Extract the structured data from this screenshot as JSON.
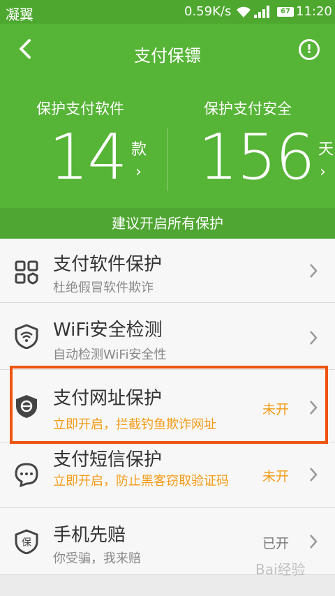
{
  "status_bar": {
    "carrier": "凝翼",
    "speed": "0.59K/s",
    "battery": "67",
    "time": "11:20"
  },
  "header": {
    "title": "支付保镖",
    "back_icon": "chevron-left-icon",
    "alert_icon": "exclamation-circle-icon"
  },
  "stats": {
    "apps": {
      "label": "保护支付软件",
      "value": "14",
      "unit": "款",
      "arrow": "›"
    },
    "days": {
      "label": "保护支付安全",
      "value": "156",
      "unit": "天",
      "arrow": "›"
    }
  },
  "recommend": "建议开启所有保护",
  "items": [
    {
      "title": "支付软件保护",
      "subtitle": "杜绝假冒软件欺诈",
      "status": "",
      "icon": "apps-grid-icon"
    },
    {
      "title": "WiFi安全检测",
      "subtitle": "自动检测WiFi安全性",
      "status": "",
      "icon": "wifi-shield-icon"
    },
    {
      "title": "支付网址保护",
      "subtitle": "立即开启，拦截钓鱼欺诈网址",
      "status": "未开",
      "icon": "browser-shield-icon"
    },
    {
      "title": "支付短信保护",
      "subtitle": "立即开启，防止黑客窃取验证码",
      "status": "未开",
      "icon": "message-icon"
    },
    {
      "title": "手机先赔",
      "subtitle": "你受骗，我来赔",
      "status": "已开",
      "icon": "insurance-shield-icon"
    }
  ],
  "colors": {
    "primary_green": "#56b436",
    "warning_orange": "#f39a14",
    "highlight_red": "#ee5511"
  },
  "watermark": "Bai经验"
}
